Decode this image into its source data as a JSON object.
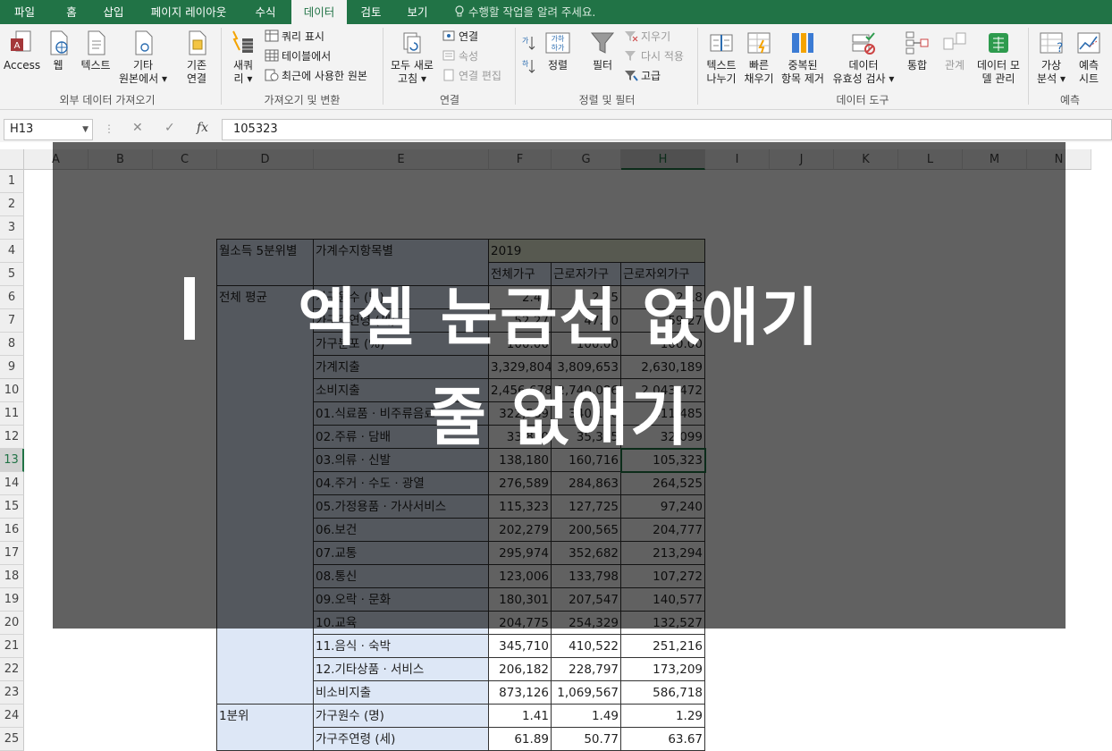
{
  "tabs": [
    {
      "label": "파일"
    },
    {
      "label": "홈"
    },
    {
      "label": "삽입"
    },
    {
      "label": "페이지 레이아웃"
    },
    {
      "label": "수식"
    },
    {
      "label": "데이터"
    },
    {
      "label": "검토"
    },
    {
      "label": "보기"
    }
  ],
  "active_tab": "데이터",
  "tell_me": "수행할 작업을 알려 주세요.",
  "ribbon": {
    "groups": {
      "external": "외부 데이터 가져오기",
      "transform": "가져오기 및 변환",
      "connections": "연결",
      "sort_filter": "정렬 및 필터",
      "data_tools": "데이터 도구",
      "forecast": "예측"
    },
    "access": "Access",
    "web": "웹",
    "text": "텍스트",
    "other_l1": "기타",
    "other_l2": "원본에서",
    "existing_l1": "기존",
    "existing_l2": "연결",
    "new_query_l1": "새쿼",
    "new_query_l2": "리",
    "show_queries": "쿼리 표시",
    "from_table": "테이블에서",
    "recent_sources": "최근에 사용한 원본",
    "refresh_l1": "모두 새로",
    "refresh_l2": "고침",
    "connections": "연결",
    "properties": "속성",
    "edit_links": "연결 편집",
    "sort": "정렬",
    "filter": "필터",
    "clear": "지우기",
    "reapply": "다시 적용",
    "advanced": "고급",
    "text_to_cols_l1": "텍스트",
    "text_to_cols_l2": "나누기",
    "flash_fill_l1": "빠른",
    "flash_fill_l2": "채우기",
    "remove_dup_l1": "중복된",
    "remove_dup_l2": "항목 제거",
    "validation_l1": "데이터",
    "validation_l2": "유효성 검사",
    "consolidate": "통합",
    "relationships": "관계",
    "data_model_l1": "데이터 모",
    "data_model_l2": "델 관리",
    "what_if_l1": "가상",
    "what_if_l2": "분석",
    "forecast_l1": "예측",
    "forecast_l2": "시트"
  },
  "formula_bar": {
    "name_box": "H13",
    "formula": "105323"
  },
  "columns": [
    "A",
    "B",
    "C",
    "D",
    "E",
    "F",
    "G",
    "H",
    "I",
    "J",
    "K",
    "L",
    "M",
    "N"
  ],
  "rows": [
    "1",
    "2",
    "3",
    "4",
    "5",
    "6",
    "7",
    "8",
    "9",
    "10",
    "11",
    "12",
    "13",
    "14",
    "15",
    "16",
    "17",
    "18",
    "19",
    "20",
    "21",
    "22",
    "23",
    "24",
    "25"
  ],
  "table": {
    "hdr_quintile": "월소득 5분위별",
    "hdr_item": "가계수지항목별",
    "hdr_year": "2019",
    "hdr_all": "전체가구",
    "hdr_worker": "근로자가구",
    "hdr_nonworker": "근로자외가구",
    "group_all": "전체 평균",
    "group_q1": "1분위",
    "data_rows": [
      {
        "item": "가구원수 (명)",
        "all": "2.41",
        "worker": "2.55",
        "nonworker": "2.18"
      },
      {
        "item": "가구주연령 (세)",
        "all": "52.27",
        "worker": "47.50",
        "nonworker": "59.27"
      },
      {
        "item": "가구분포 (%)",
        "all": "100.00",
        "worker": "100.00",
        "nonworker": "100.00"
      },
      {
        "item": "가계지출",
        "all": "3,329,804",
        "worker": "3,809,653",
        "nonworker": "2,630,189"
      },
      {
        "item": "소비지출",
        "all": "2,456,678",
        "worker": "2,740,086",
        "nonworker": "2,043,472"
      },
      {
        "item": "01.식료품 · 비주류음료",
        "all": "322,589",
        "worker": "340,190",
        "nonworker": "311,485"
      },
      {
        "item": "02.주류 · 담배",
        "all": "33,800",
        "worker": "35,335",
        "nonworker": "32,099"
      },
      {
        "item": "03.의류 · 신발",
        "all": "138,180",
        "worker": "160,716",
        "nonworker": "105,323"
      },
      {
        "item": "04.주거 · 수도 · 광열",
        "all": "276,589",
        "worker": "284,863",
        "nonworker": "264,525"
      },
      {
        "item": "05.가정용품 · 가사서비스",
        "all": "115,323",
        "worker": "127,725",
        "nonworker": "97,240"
      },
      {
        "item": "06.보건",
        "all": "202,279",
        "worker": "200,565",
        "nonworker": "204,777"
      },
      {
        "item": "07.교통",
        "all": "295,974",
        "worker": "352,682",
        "nonworker": "213,294"
      },
      {
        "item": "08.통신",
        "all": "123,006",
        "worker": "133,798",
        "nonworker": "107,272"
      },
      {
        "item": "09.오락 · 문화",
        "all": "180,301",
        "worker": "207,547",
        "nonworker": "140,577"
      },
      {
        "item": "10.교육",
        "all": "204,775",
        "worker": "254,329",
        "nonworker": "132,527"
      },
      {
        "item": "11.음식 · 숙박",
        "all": "345,710",
        "worker": "410,522",
        "nonworker": "251,216"
      },
      {
        "item": "12.기타상품 · 서비스",
        "all": "206,182",
        "worker": "228,797",
        "nonworker": "173,209"
      },
      {
        "item": "비소비지출",
        "all": "873,126",
        "worker": "1,069,567",
        "nonworker": "586,718"
      },
      {
        "item": "가구원수 (명)",
        "all": "1.41",
        "worker": "1.49",
        "nonworker": "1.29"
      },
      {
        "item": "가구주연령 (세)",
        "all": "61.89",
        "worker": "50.77",
        "nonworker": "63.67"
      }
    ]
  },
  "overlay": {
    "line1": "엑셀 눈금선 없애기",
    "line2": "줄 없애기"
  }
}
